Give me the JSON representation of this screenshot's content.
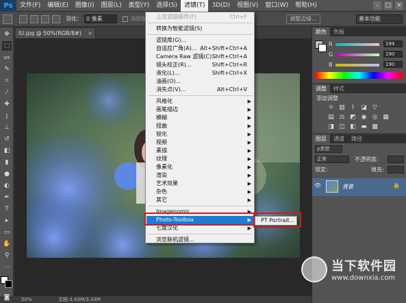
{
  "app": {
    "logo": "Ps"
  },
  "menubar": {
    "items": [
      "文件(F)",
      "编辑(E)",
      "图像(I)",
      "图层(L)",
      "类型(Y)",
      "选择(S)",
      "滤镜(T)",
      "3D(D)",
      "视图(V)",
      "窗口(W)",
      "帮助(H)"
    ],
    "active_index": 6,
    "window_controls": [
      "-",
      "□",
      "×"
    ]
  },
  "options_bar": {
    "feather_label": "羽化：",
    "feather_value": "0 像素",
    "antialias_label": "消除锯齿",
    "refine_edge_label": "调整边缘...",
    "workspace_value": "基本功能"
  },
  "document": {
    "tab_title": "IU.jpg @ 50%(RGB/8#)",
    "tab_close": "×"
  },
  "status_bar": {
    "zoom": "50%",
    "doc_info": "文档:3.43M/3.43M"
  },
  "filter_menu": {
    "items": [
      {
        "label": "上次滤镜操作(F)",
        "shortcut": "Ctrl+F",
        "disabled": true
      },
      {
        "separator": true
      },
      {
        "label": "转换为智能滤镜(S)"
      },
      {
        "separator": true
      },
      {
        "label": "滤镜库(G)..."
      },
      {
        "label": "自适应广角(A)...",
        "shortcut": "Alt+Shift+Ctrl+A"
      },
      {
        "label": "Camera Raw 滤镜(C)...",
        "shortcut": "Shift+Ctrl+A"
      },
      {
        "label": "镜头校正(R)...",
        "shortcut": "Shift+Ctrl+R"
      },
      {
        "label": "液化(L)...",
        "shortcut": "Shift+Ctrl+X"
      },
      {
        "label": "油画(O)..."
      },
      {
        "label": "消失点(V)...",
        "shortcut": "Alt+Ctrl+V"
      },
      {
        "separator": true
      },
      {
        "label": "风格化",
        "submenu": true
      },
      {
        "label": "画笔描边",
        "submenu": true
      },
      {
        "label": "模糊",
        "submenu": true
      },
      {
        "label": "扭曲",
        "submenu": true
      },
      {
        "label": "锐化",
        "submenu": true
      },
      {
        "label": "视频",
        "submenu": true
      },
      {
        "label": "素描",
        "submenu": true
      },
      {
        "label": "纹理",
        "submenu": true
      },
      {
        "label": "像素化",
        "submenu": true
      },
      {
        "label": "渲染",
        "submenu": true
      },
      {
        "label": "艺术效果",
        "submenu": true
      },
      {
        "label": "杂色",
        "submenu": true
      },
      {
        "label": "其它",
        "submenu": true
      },
      {
        "separator": true
      },
      {
        "label": "Imagenomic",
        "submenu": true
      },
      {
        "label": "Photo-Toolbox",
        "submenu": true,
        "highlighted": true
      },
      {
        "label": "七度汉化",
        "submenu": true
      },
      {
        "separator": true
      },
      {
        "label": "浏览联机滤镜..."
      }
    ],
    "submenu_item": "PT Portrait..."
  },
  "color_panel": {
    "tabs": [
      "颜色",
      "色板"
    ],
    "r_label": "R",
    "r_value": "194",
    "g_label": "G",
    "g_value": "190",
    "b_label": "B",
    "b_value": "190"
  },
  "adjustments_panel": {
    "tabs": [
      "调整",
      "样式"
    ],
    "title": "添加调整"
  },
  "layers_panel": {
    "tabs": [
      "图层",
      "通道",
      "路径"
    ],
    "kind_label": "ρ类型",
    "blend_mode": "正常",
    "opacity_label": "不透明度:",
    "lock_label": "锁定:",
    "fill_label": "填充:",
    "layer_name": "背景",
    "layer_lock": "🔒",
    "visibility": "👁"
  },
  "watermark": {
    "brand": "当下软件园",
    "url": "www.downxia.com"
  },
  "colors": {
    "menu_highlight": "#1e7bd3",
    "callout_red": "#d21a1a",
    "photo_blue": "#5d7fd6",
    "photo_green": "#7c9b62"
  }
}
